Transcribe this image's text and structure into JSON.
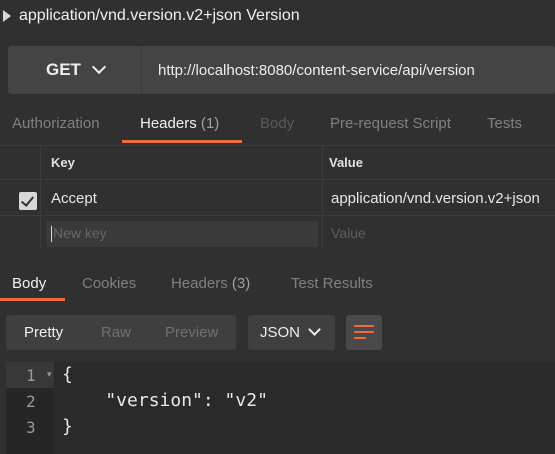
{
  "request": {
    "title": "application/vnd.version.v2+json Version",
    "method": "GET",
    "url": "http://localhost:8080/content-service/api/version"
  },
  "request_tabs": [
    {
      "label": "Authorization"
    },
    {
      "label": "Headers",
      "count": "(1)"
    },
    {
      "label": "Body"
    },
    {
      "label": "Pre-request Script"
    },
    {
      "label": "Tests"
    }
  ],
  "headers_table": {
    "columns": [
      "Key",
      "Value"
    ],
    "rows": [
      {
        "checked": true,
        "key": "Accept",
        "value": "application/vnd.version.v2+json"
      }
    ],
    "new_key_placeholder": "New key",
    "new_value_placeholder": "Value"
  },
  "response_tabs": [
    {
      "label": "Body"
    },
    {
      "label": "Cookies"
    },
    {
      "label": "Headers",
      "count": "(3)"
    },
    {
      "label": "Test Results"
    }
  ],
  "view_modes": [
    "Pretty",
    "Raw",
    "Preview"
  ],
  "format": "JSON",
  "response_body": {
    "line_numbers": [
      "1",
      "2",
      "3"
    ],
    "lines": [
      "{",
      "    \"version\": \"v2\"",
      "}"
    ]
  },
  "colors": {
    "accent": "#f26b3a",
    "background": "#303030"
  },
  "icons": {
    "title": "caret-right-icon",
    "method_dropdown": "chevron-down-icon",
    "wrap": "wrap-lines-icon",
    "checkbox": "checkmark-icon"
  }
}
